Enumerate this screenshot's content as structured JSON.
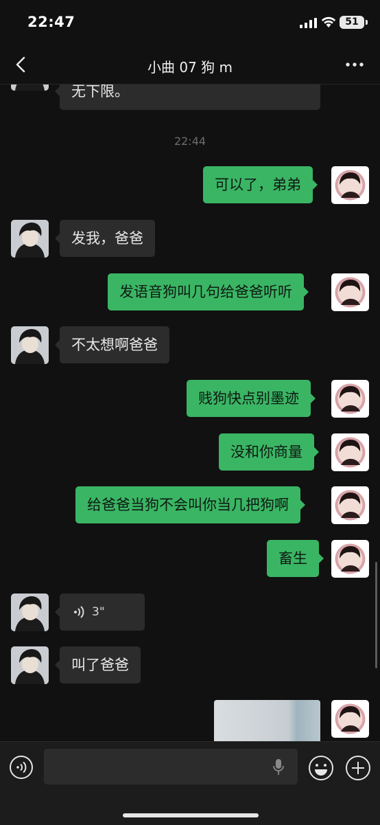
{
  "status": {
    "time": "22:47",
    "battery": "51"
  },
  "header": {
    "title": "小曲 07 狗 m"
  },
  "messages": {
    "m0": "无下限。",
    "ts1": "22:44",
    "m1": "可以了，弟弟",
    "m2": "发我，爸爸",
    "m3": "发语音狗叫几句给爸爸听听",
    "m4": "不太想啊爸爸",
    "m5": "贱狗快点别墨迹",
    "m6": "没和你商量",
    "m7": "给爸爸当狗不会叫你当几把狗啊",
    "m8": "畜生",
    "m9_voice_duration": "3\"",
    "m10": "叫了爸爸"
  },
  "colors": {
    "outgoing_bubble": "#3ab564",
    "incoming_bubble": "#2c2c2c",
    "background": "#111111"
  }
}
